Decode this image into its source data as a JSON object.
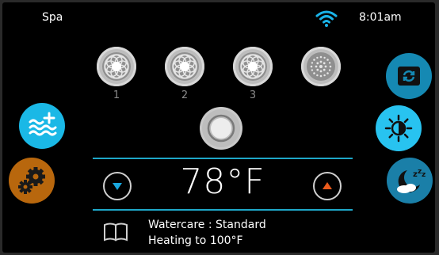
{
  "status": {
    "title": "Spa",
    "time": "8:01am",
    "wifi_icon": "wifi-icon"
  },
  "pumps": [
    {
      "label": "1",
      "icon": "jet-pump-icon"
    },
    {
      "label": "2",
      "icon": "jet-pump-icon"
    },
    {
      "label": "3",
      "icon": "jet-pump-icon"
    },
    {
      "label": "",
      "icon": "blower-icon"
    }
  ],
  "center_button": {
    "icon": "circle-button-icon"
  },
  "left_buttons": [
    {
      "icon": "heat-water-icon",
      "color": "#1ab8e6"
    },
    {
      "icon": "settings-gears-icon",
      "color": "#b8670d"
    }
  ],
  "right_buttons": [
    {
      "icon": "flip-screen-icon",
      "color": "#1589b3"
    },
    {
      "icon": "light-brightness-icon",
      "color": "#28c3f0"
    },
    {
      "icon": "sleep-mode-icon",
      "color": "#1a7fa8"
    }
  ],
  "temperature": {
    "value": "78°F",
    "down_icon": "temp-down-icon",
    "down_color": "#19a7df",
    "up_icon": "temp-up-icon",
    "up_color": "#ea5a1c"
  },
  "info": {
    "watercare": "Watercare : Standard",
    "heating": "Heating to 100°F",
    "icon": "book-icon"
  },
  "colors": {
    "accent": "#1ea7c8"
  }
}
